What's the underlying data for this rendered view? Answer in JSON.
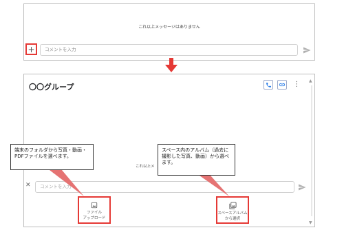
{
  "top": {
    "empty_message": "これ以上メッセージはありません",
    "add_icon_glyph": "+",
    "input_placeholder": "コメントを入力"
  },
  "bottom": {
    "group_title": "〇〇グループ",
    "more_glyph": "⋮",
    "scroll_up_glyph": "▲",
    "scroll_down_glyph": "▼",
    "empty_message": "これ以上メ",
    "close_glyph": "✕",
    "input_placeholder": "コメントを入力",
    "file_upload_line1": "ファイル",
    "file_upload_line2": "アップロード",
    "album_line1": "スペースアルバム",
    "album_line2": "から選択"
  },
  "callouts": {
    "file": "端末のフォルダから写真・動画・PDFファイルを選べます。",
    "album": "スペース内のアルバム（過去に撮影した写真、動画）から選べます。"
  },
  "colors": {
    "highlight": "#e53935",
    "accent_blue": "#1a73e8",
    "border": "#bdbdbd"
  },
  "icons": [
    "plus-icon",
    "send-icon",
    "phone-icon",
    "link-icon",
    "more-vert-icon",
    "close-icon",
    "image-icon",
    "photo-library-icon",
    "arrow-down-icon"
  ]
}
